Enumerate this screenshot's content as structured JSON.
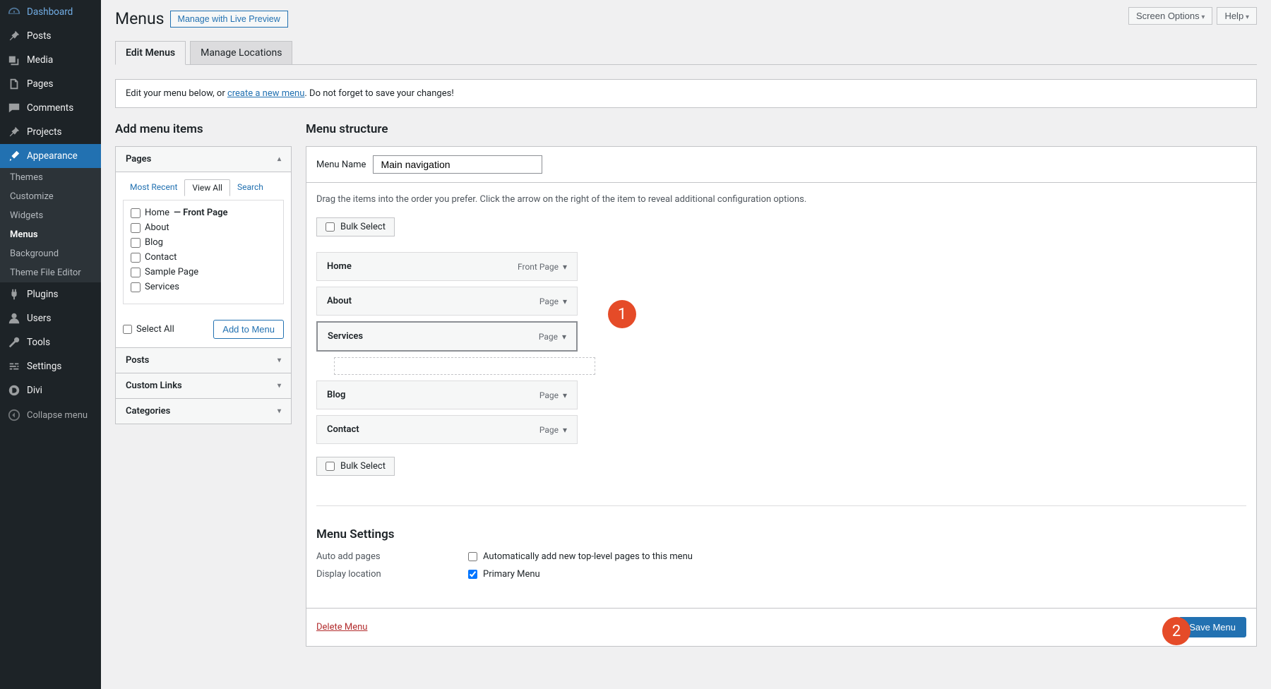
{
  "topbar": {
    "screen_options": "Screen Options",
    "help": "Help"
  },
  "sidebar": {
    "items": [
      {
        "label": "Dashboard"
      },
      {
        "label": "Posts"
      },
      {
        "label": "Media"
      },
      {
        "label": "Pages"
      },
      {
        "label": "Comments"
      },
      {
        "label": "Projects"
      },
      {
        "label": "Appearance"
      },
      {
        "label": "Plugins"
      },
      {
        "label": "Users"
      },
      {
        "label": "Tools"
      },
      {
        "label": "Settings"
      },
      {
        "label": "Divi"
      }
    ],
    "subitems": [
      {
        "label": "Themes"
      },
      {
        "label": "Customize"
      },
      {
        "label": "Widgets"
      },
      {
        "label": "Menus"
      },
      {
        "label": "Background"
      },
      {
        "label": "Theme File Editor"
      }
    ],
    "collapse": "Collapse menu"
  },
  "header": {
    "title": "Menus",
    "live_preview": "Manage with Live Preview"
  },
  "tabs": {
    "edit": "Edit Menus",
    "locations": "Manage Locations"
  },
  "notice": {
    "pre": "Edit your menu below, or ",
    "link": "create a new menu",
    "post": ". Do not forget to save your changes!"
  },
  "left": {
    "title": "Add menu items",
    "pages": "Pages",
    "subtabs": {
      "recent": "Most Recent",
      "viewall": "View All",
      "search": "Search"
    },
    "items": [
      {
        "label": "Home",
        "suffix": " — Front Page"
      },
      {
        "label": "About"
      },
      {
        "label": "Blog"
      },
      {
        "label": "Contact"
      },
      {
        "label": "Sample Page"
      },
      {
        "label": "Services"
      }
    ],
    "select_all": "Select All",
    "add_to_menu": "Add to Menu",
    "posts": "Posts",
    "custom": "Custom Links",
    "categories": "Categories"
  },
  "right": {
    "title": "Menu structure",
    "name_label": "Menu Name",
    "name_value": "Main navigation",
    "hint": "Drag the items into the order you prefer. Click the arrow on the right of the item to reveal additional configuration options.",
    "bulk": "Bulk Select",
    "items": [
      {
        "label": "Home",
        "type": "Front Page"
      },
      {
        "label": "About",
        "type": "Page"
      },
      {
        "label": "Services",
        "type": "Page"
      },
      {
        "label": "Blog",
        "type": "Page"
      },
      {
        "label": "Contact",
        "type": "Page"
      }
    ],
    "settings_title": "Menu Settings",
    "auto_add_label": "Auto add pages",
    "auto_add_val": "Automatically add new top-level pages to this menu",
    "display_loc_label": "Display location",
    "primary": "Primary Menu",
    "delete": "Delete Menu",
    "save": "Save Menu"
  },
  "callouts": {
    "one": "1",
    "two": "2"
  }
}
